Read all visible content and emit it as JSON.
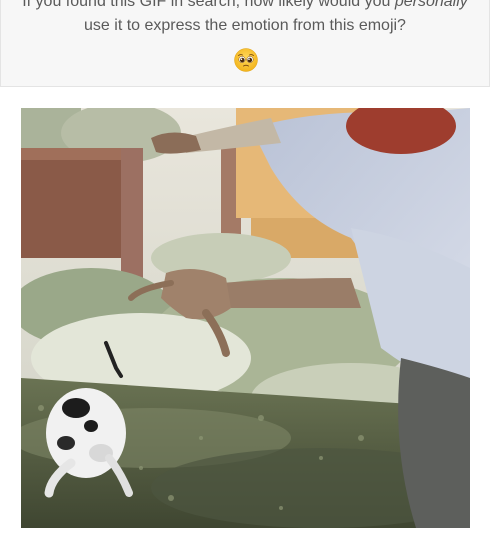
{
  "question": {
    "line1_prefix": "If you found this GIF in search, how likely would you ",
    "line1_emphasis": "personally",
    "line2": "use it to express the emotion from this emoji?",
    "emoji_icon": "pleading-face-icon"
  },
  "gif": {
    "icon": "gif-image"
  },
  "colors": {
    "card_bg": "#f7f7f7",
    "text": "#5a5a5a",
    "emoji_yellow": "#f7c325"
  }
}
